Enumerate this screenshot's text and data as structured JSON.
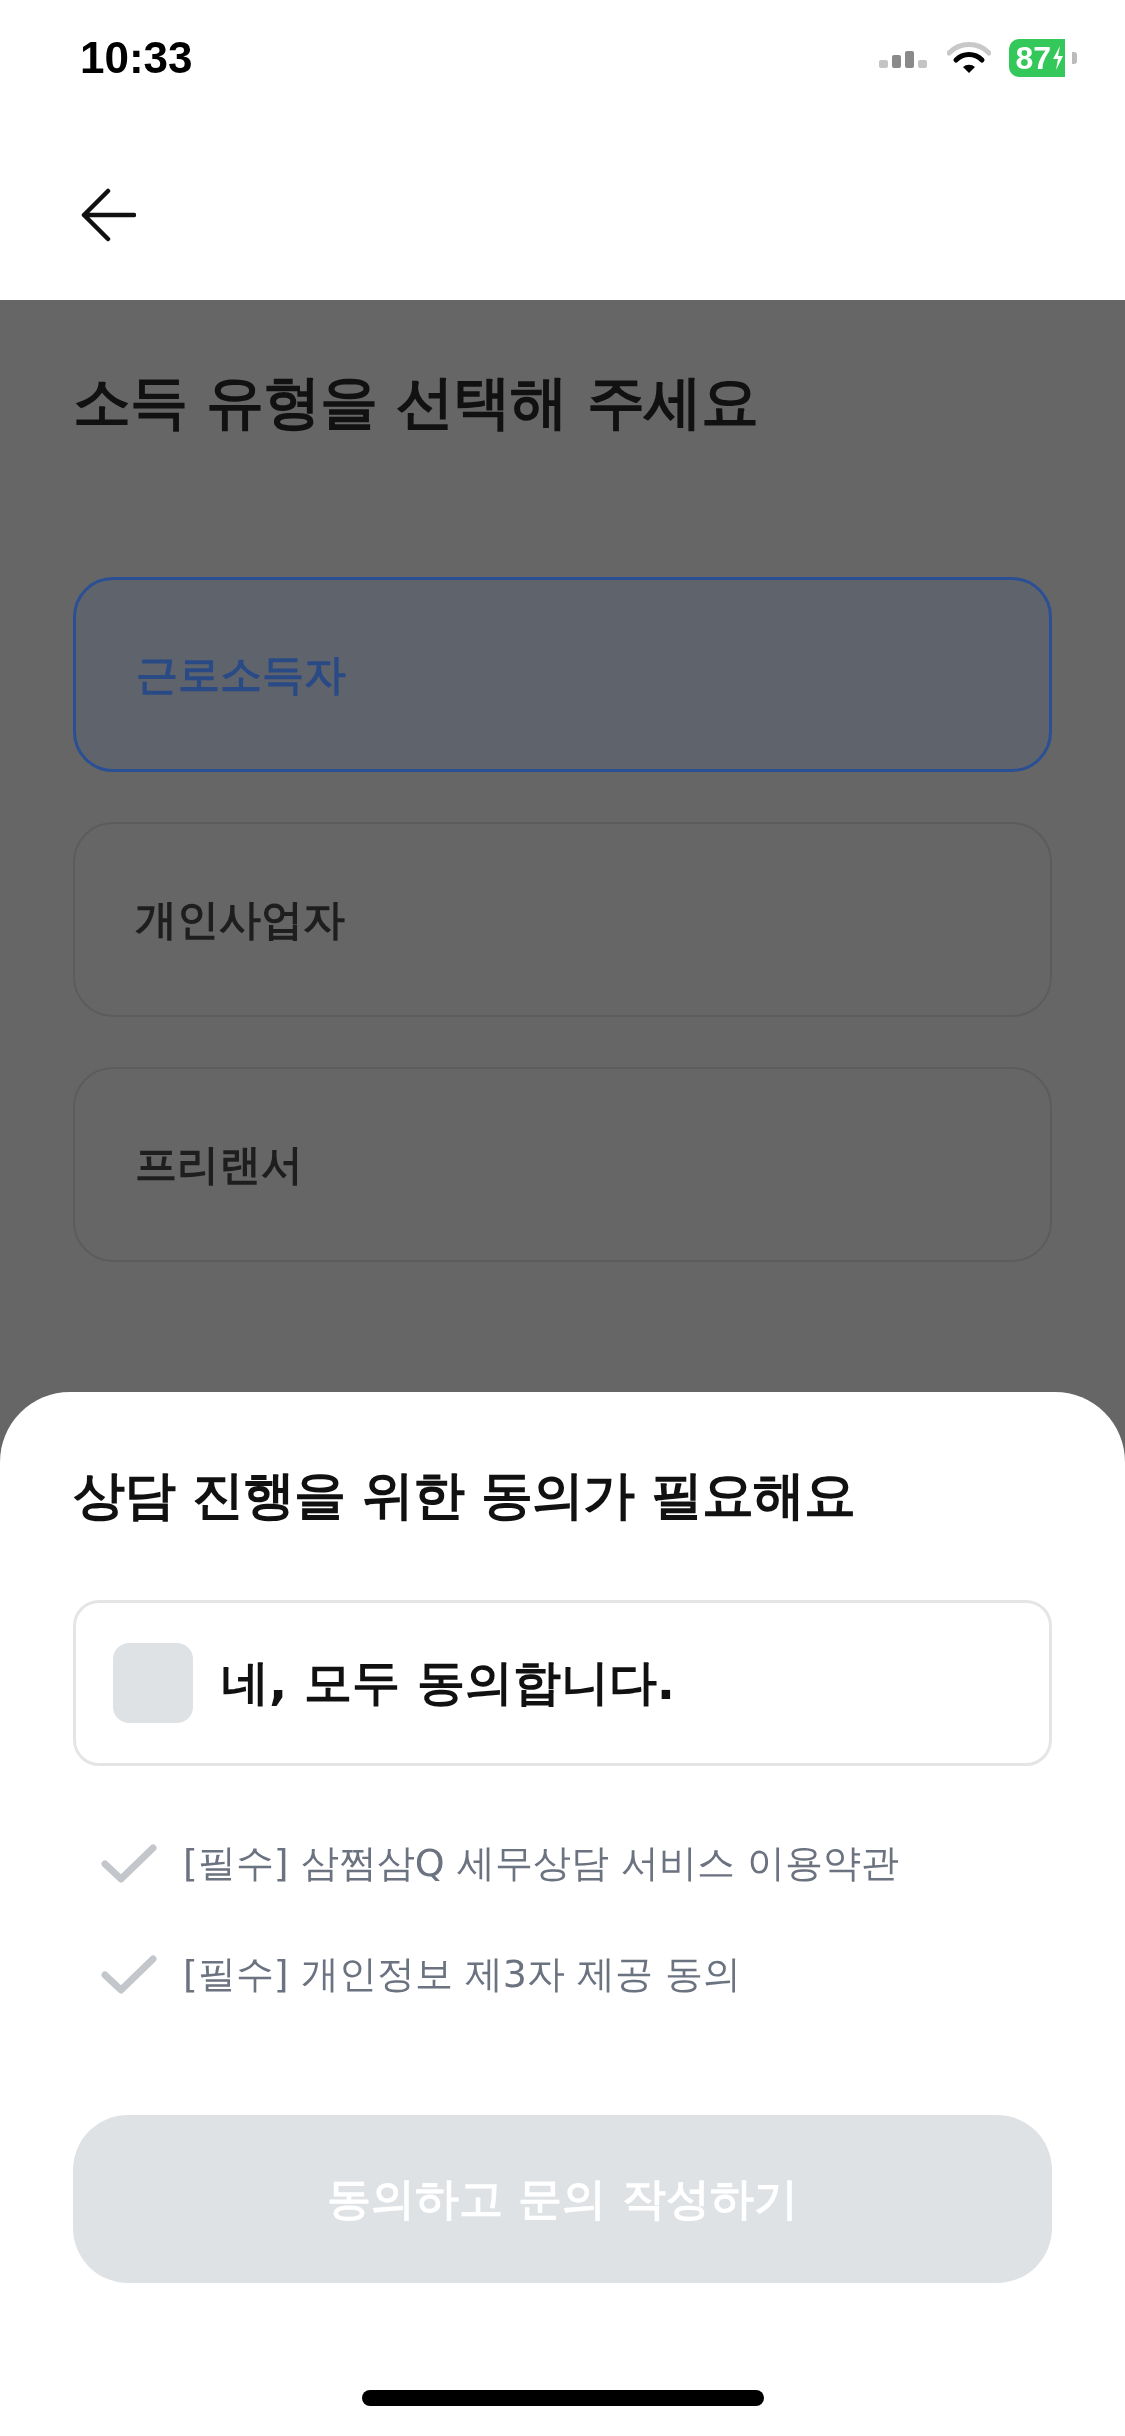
{
  "status_bar": {
    "time": "10:33",
    "battery": "87"
  },
  "page": {
    "title": "소득 유형을 선택해 주세요",
    "options": [
      {
        "label": "근로소득자",
        "selected": true
      },
      {
        "label": "개인사업자",
        "selected": false
      },
      {
        "label": "프리랜서",
        "selected": false
      }
    ]
  },
  "sheet": {
    "title": "상담 진행을 위한 동의가 필요해요",
    "agree_all": {
      "label": "네, 모두 동의합니다.",
      "checked": false
    },
    "terms": [
      {
        "label": "[필수] 삼쩜삼Q 세무상담 서비스 이용약관",
        "checked": false
      },
      {
        "label": "[필수] 개인정보 제3자 제공 동의",
        "checked": false
      }
    ],
    "submit": {
      "label": "동의하고 문의 작성하기",
      "disabled": true
    }
  }
}
